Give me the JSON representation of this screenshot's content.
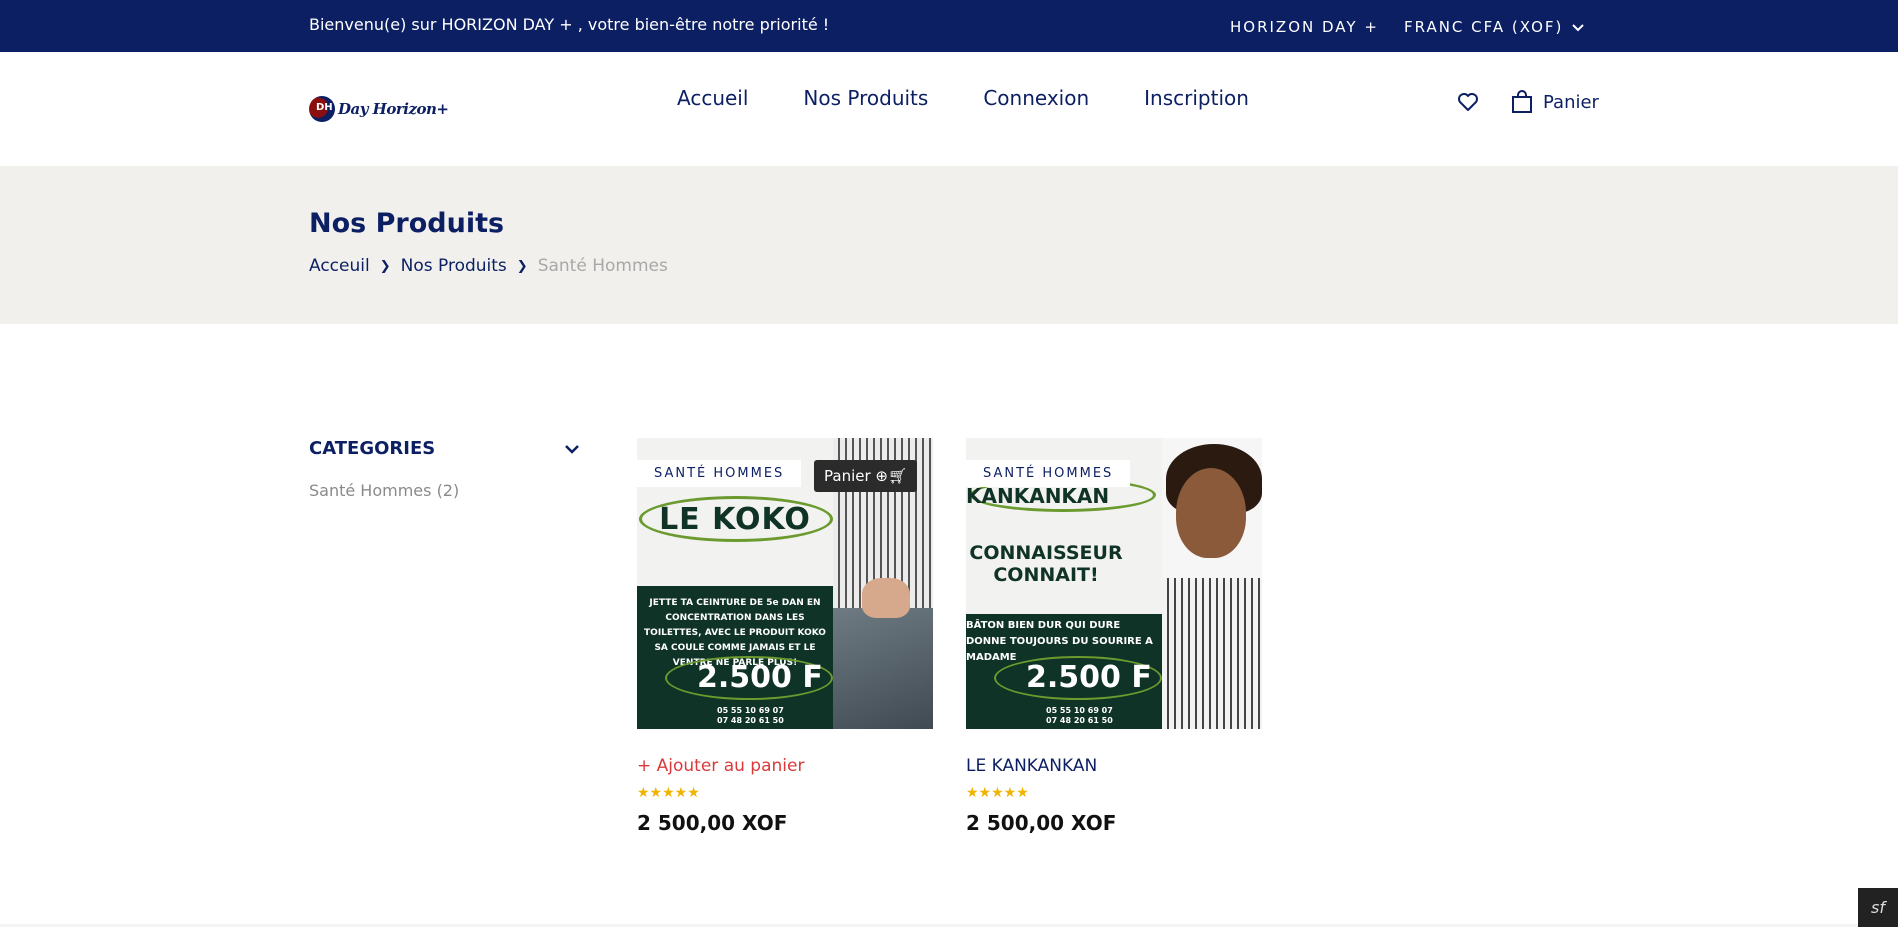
{
  "topbar": {
    "welcome": "Bienvenu(e) sur HORIZON DAY + , votre bien-être notre priorité !",
    "brand": "HORIZON DAY +",
    "currency": "FRANC CFA (XOF)"
  },
  "header": {
    "logo_text": "Day Horizon+",
    "logo_mark": "DH",
    "nav": [
      "Accueil",
      "Nos Produits",
      "Connexion",
      "Inscription"
    ],
    "cart_label": "Panier"
  },
  "hero": {
    "title": "Nos Produits",
    "breadcrumb": [
      "Acceuil",
      "Nos Produits",
      "Santé Hommes"
    ]
  },
  "sidebar": {
    "heading": "CATEGORIES",
    "items": [
      "Santé Hommes (2)"
    ]
  },
  "products": [
    {
      "badge": "SANTÉ HOMMES",
      "cart_button": "Panier",
      "poster_title": "LE KOKO",
      "poster_text": "JETTE TA CEINTURE DE 5e DAN EN CONCENTRATION DANS LES TOILETTES, AVEC LE PRODUIT KOKO SA COULE COMME JAMAIS ET LE VENTRE NE PARLE PLUS!",
      "poster_price": "2.500 F",
      "poster_phones": [
        "05 55 10 69 07",
        "07 48 20 61 50"
      ],
      "name": "+ Ajouter au panier",
      "stars": "★★★★★",
      "price": "2 500,00 XOF"
    },
    {
      "badge": "SANTÉ HOMMES",
      "poster_title": "KANKANKAN",
      "poster_slogan": "CONNAISSEUR CONNAIT!",
      "poster_text": "BÂTON BIEN DUR QUI DURE DONNE TOUJOURS DU SOURIRE A MADAME",
      "poster_price": "2.500 F",
      "poster_phones": [
        "05 55 10 69 07",
        "07 48 20 61 50"
      ],
      "name": "LE KANKANKAN",
      "stars": "★★★★★",
      "price": "2 500,00 XOF"
    }
  ],
  "debug_badge": "sf"
}
